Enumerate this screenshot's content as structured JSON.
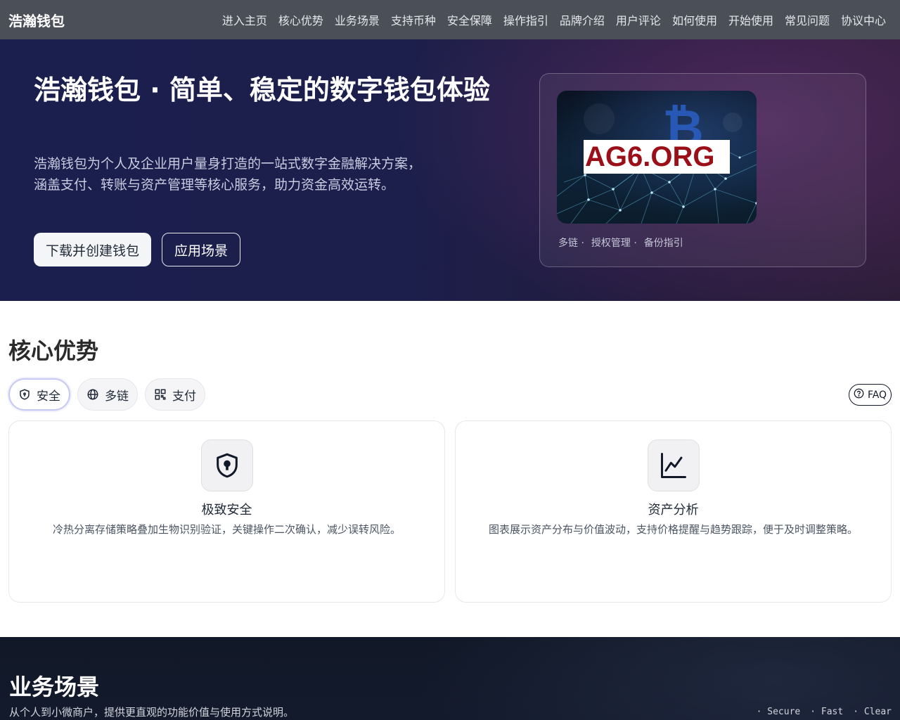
{
  "nav": {
    "brand": "浩瀚钱包",
    "links": [
      "进入主页",
      "核心优势",
      "业务场景",
      "支持币种",
      "安全保障",
      "操作指引",
      "品牌介绍",
      "用户评论",
      "如何使用",
      "开始使用",
      "常见问题",
      "协议中心"
    ]
  },
  "hero": {
    "title": "浩瀚钱包 · 简单、稳定的数字钱包体验",
    "description": "浩瀚钱包为个人及企业用户量身打造的一站式数字金融解决方案，涵盖支付、转账与资产管理等核心服务，助力资金高效运转。",
    "primary_button": "下载并创建钱包",
    "secondary_button": "应用场景",
    "card": {
      "logo_text": "AG6.ORG",
      "tags": [
        "多链 ·",
        "授权管理 ·",
        "备份指引"
      ]
    }
  },
  "advantages": {
    "title": "核心优势",
    "tabs": [
      {
        "label": "安全",
        "icon": "shield-icon",
        "active": true
      },
      {
        "label": "多链",
        "icon": "globe-icon",
        "active": false
      },
      {
        "label": "支付",
        "icon": "qr-icon",
        "active": false
      }
    ],
    "faq_label": "FAQ",
    "cards": [
      {
        "title": "极致安全",
        "desc": "冷热分离存储策略叠加生物识别验证，关键操作二次确认，减少误转风险。",
        "icon": "shield-lock-icon"
      },
      {
        "title": "资产分析",
        "desc": "图表展示资产分布与价值波动，支持价格提醒与趋势跟踪，便于及时调整策略。",
        "icon": "line-chart-icon"
      }
    ]
  },
  "scenarios": {
    "title": "业务场景",
    "description": "从个人到小微商户，提供更直观的功能价值与使用方式说明。",
    "chips": [
      "· Secure",
      "· Fast",
      "· Clear"
    ]
  },
  "colors": {
    "nav_bg": "#4b4f58",
    "hero_bg": "#1c1f4b",
    "accent_border": "#c7c9f5",
    "scenarios_bg": "#111827"
  }
}
